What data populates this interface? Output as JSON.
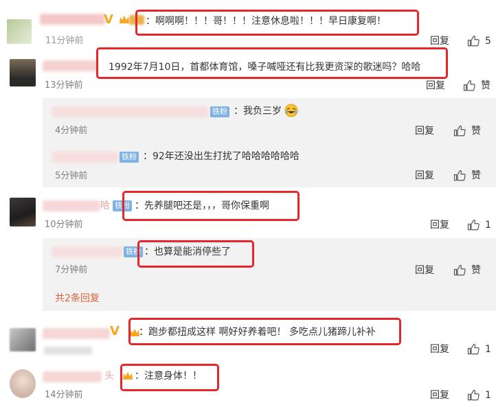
{
  "comments": [
    {
      "text": "：啊啊啊！！！哥！！！注意休息啦！！！早日康复啊！",
      "time": "11分钟前",
      "reply_label": "回复",
      "like_label": "5"
    },
    {
      "text": "1992年7月10日，首都体育馆，嗓子喊哑还有比我更资深的歌迷吗？哈哈",
      "time": "13分钟前",
      "reply_label": "回复",
      "like_label": "赞",
      "sub_replies": [
        {
          "badge": "铁粉",
          "text": "：我负三岁",
          "time": "4分钟前",
          "reply_label": "回复",
          "like_label": "赞"
        },
        {
          "badge": "铁粉",
          "text": "：92年还没出生打扰了哈哈哈哈哈哈",
          "time": "5分钟前",
          "reply_label": "回复",
          "like_label": "赞"
        }
      ]
    },
    {
      "badge": "铁粉",
      "name_tail": "哈",
      "text": "：先养腿吧还是，，，哥你保重啊",
      "time": "10分钟前",
      "reply_label": "回复",
      "like_label": "1",
      "sub_replies": [
        {
          "badge": "铁粉",
          "text": "：也算是能消停些了",
          "time": "7分钟前",
          "reply_label": "回复",
          "like_label": "赞"
        }
      ],
      "more_label": "共2条回复"
    },
    {
      "text": "：跑步都扭成这样 啊好好养着吧！ 多吃点儿猪蹄儿补补",
      "time": "",
      "reply_label": "回复",
      "like_label": "1"
    },
    {
      "name_tail": "头",
      "text": "：注意身体！！",
      "time": "14分钟前",
      "reply_label": "回复",
      "like_label": "1"
    }
  ],
  "icons": {
    "like": "thumbs-up-icon",
    "verified": "v-verified-icon",
    "fan_crown": "crown-icon",
    "emoji": "laughing-emoji-icon"
  },
  "colors": {
    "highlight": "#e5262a",
    "badge": "#7fb1e3",
    "more_link": "#d8643a",
    "sub_background": "#f2f2f2"
  }
}
